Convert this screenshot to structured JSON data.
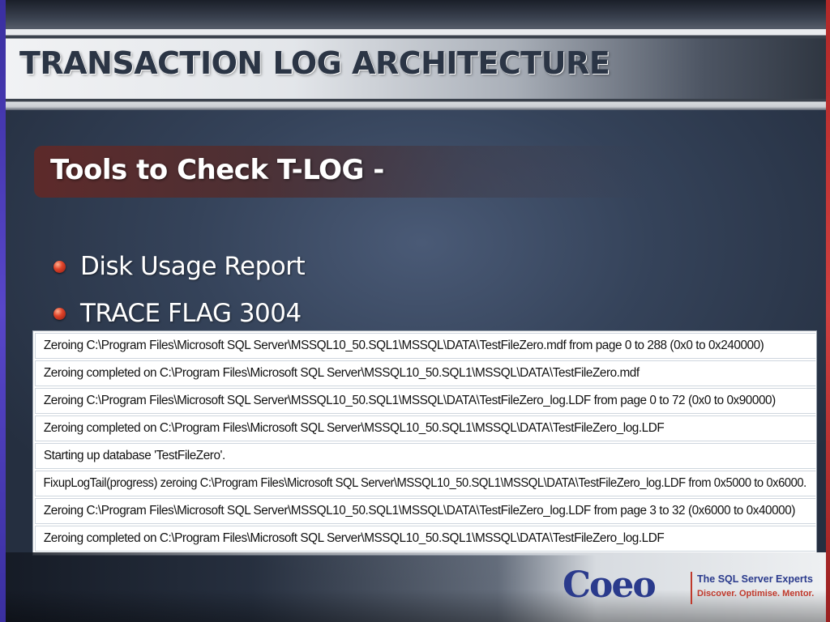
{
  "slide": {
    "title": "TRANSACTION LOG ARCHITECTURE",
    "subtitle": "Tools to Check T-LOG -",
    "bullets": [
      "Disk Usage Report",
      "TRACE FLAG 3004"
    ],
    "bullet_icon": "red-sphere-bullet-icon"
  },
  "log_output": {
    "rows": [
      "Zeroing C:\\Program Files\\Microsoft SQL Server\\MSSQL10_50.SQL1\\MSSQL\\DATA\\TestFileZero.mdf from page 0 to 288 (0x0 to 0x240000)",
      "Zeroing completed on C:\\Program Files\\Microsoft SQL Server\\MSSQL10_50.SQL1\\MSSQL\\DATA\\TestFileZero.mdf",
      "Zeroing C:\\Program Files\\Microsoft SQL Server\\MSSQL10_50.SQL1\\MSSQL\\DATA\\TestFileZero_log.LDF from page 0 to 72 (0x0 to 0x90000)",
      "Zeroing completed on C:\\Program Files\\Microsoft SQL Server\\MSSQL10_50.SQL1\\MSSQL\\DATA\\TestFileZero_log.LDF",
      "Starting up database 'TestFileZero'.",
      "FixupLogTail(progress) zeroing C:\\Program Files\\Microsoft SQL Server\\MSSQL10_50.SQL1\\MSSQL\\DATA\\TestFileZero_log.LDF from 0x5000 to 0x6000.",
      "Zeroing C:\\Program Files\\Microsoft SQL Server\\MSSQL10_50.SQL1\\MSSQL\\DATA\\TestFileZero_log.LDF from page 3 to 32 (0x6000 to 0x40000)",
      "Zeroing completed on C:\\Program Files\\Microsoft SQL Server\\MSSQL10_50.SQL1\\MSSQL\\DATA\\TestFileZero_log.LDF"
    ]
  },
  "branding": {
    "logo_text": "Coeo",
    "tagline": "The SQL Server Experts",
    "motto": "Discover. Optimise. Mentor.",
    "colors": {
      "brand_blue": "#2a3a8c",
      "brand_red": "#c0392b"
    }
  },
  "colors": {
    "title_text": "#2b3545",
    "subtitle_bar": "#5d2a2a",
    "bullet": "#e0442a",
    "background": "#35435a"
  }
}
